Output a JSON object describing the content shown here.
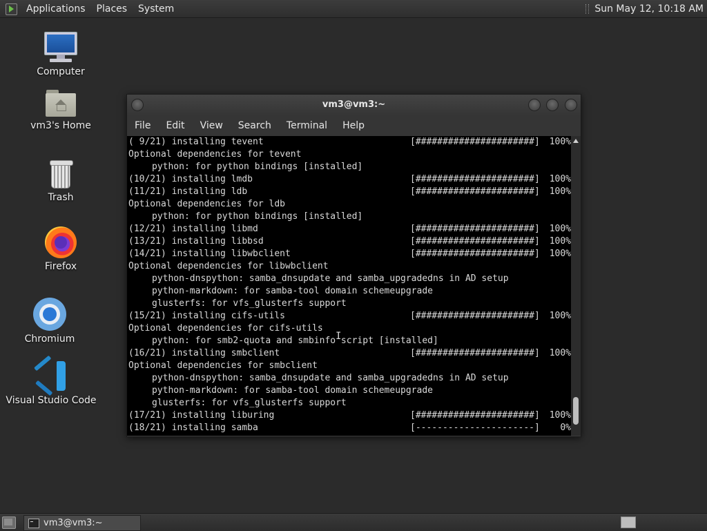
{
  "top_panel": {
    "menus": [
      "Applications",
      "Places",
      "System"
    ],
    "clock": "Sun May 12, 10:18 AM"
  },
  "desktop_icons": [
    {
      "label": "Computer",
      "icon": "computer-icon"
    },
    {
      "label": "vm3's Home",
      "icon": "home-folder-icon"
    },
    {
      "label": "Trash",
      "icon": "trash-icon"
    },
    {
      "label": "Firefox",
      "icon": "firefox-icon"
    },
    {
      "label": "Chromium",
      "icon": "chromium-icon"
    },
    {
      "label": "Visual Studio Code",
      "icon": "vscode-icon"
    }
  ],
  "terminal": {
    "title": "vm3@vm3:~",
    "menu": [
      "File",
      "Edit",
      "View",
      "Search",
      "Terminal",
      "Help"
    ],
    "lines": [
      {
        "text": "( 9/21) installing tevent",
        "prog": "[######################]",
        "pct": "100%"
      },
      {
        "text": "Optional dependencies for tevent"
      },
      {
        "text": "python: for python bindings [installed]",
        "indent": true
      },
      {
        "text": "(10/21) installing lmdb",
        "prog": "[######################]",
        "pct": "100%"
      },
      {
        "text": "(11/21) installing ldb",
        "prog": "[######################]",
        "pct": "100%"
      },
      {
        "text": "Optional dependencies for ldb"
      },
      {
        "text": "python: for python bindings [installed]",
        "indent": true
      },
      {
        "text": "(12/21) installing libmd",
        "prog": "[######################]",
        "pct": "100%"
      },
      {
        "text": "(13/21) installing libbsd",
        "prog": "[######################]",
        "pct": "100%"
      },
      {
        "text": "(14/21) installing libwbclient",
        "prog": "[######################]",
        "pct": "100%"
      },
      {
        "text": "Optional dependencies for libwbclient"
      },
      {
        "text": "python-dnspython: samba_dnsupdate and samba_upgradedns in AD setup",
        "indent": true
      },
      {
        "text": "python-markdown: for samba-tool domain schemeupgrade",
        "indent": true
      },
      {
        "text": "glusterfs: for vfs_glusterfs support",
        "indent": true
      },
      {
        "text": "(15/21) installing cifs-utils",
        "prog": "[######################]",
        "pct": "100%"
      },
      {
        "text": "Optional dependencies for cifs-utils"
      },
      {
        "text": "python: for smb2-quota and smbinfo script [installed]",
        "indent": true
      },
      {
        "text": "(16/21) installing smbclient",
        "prog": "[######################]",
        "pct": "100%"
      },
      {
        "text": "Optional dependencies for smbclient"
      },
      {
        "text": "python-dnspython: samba_dnsupdate and samba_upgradedns in AD setup",
        "indent": true
      },
      {
        "text": "python-markdown: for samba-tool domain schemeupgrade",
        "indent": true
      },
      {
        "text": "glusterfs: for vfs_glusterfs support",
        "indent": true
      },
      {
        "text": "(17/21) installing liburing",
        "prog": "[######################]",
        "pct": "100%"
      },
      {
        "text": "(18/21) installing samba",
        "prog": "[----------------------]",
        "pct": "0%"
      }
    ]
  },
  "taskbar": {
    "window_button": "vm3@vm3:~"
  }
}
